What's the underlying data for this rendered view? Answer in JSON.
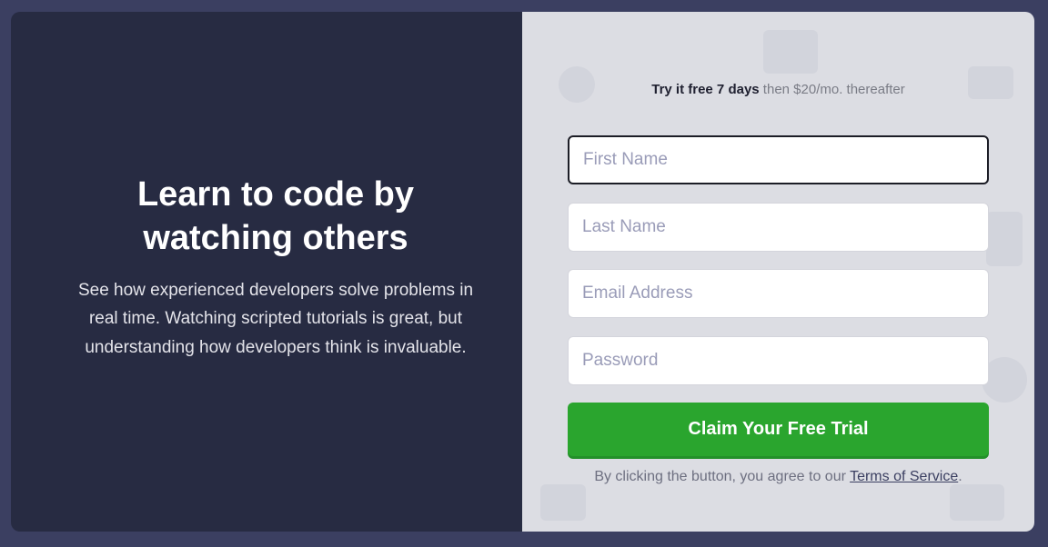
{
  "hero": {
    "headline_line1": "Learn to code by",
    "headline_line2": "watching others",
    "description": "See how experienced developers solve problems in real time. Watching scripted tutorials is great, but understanding how developers think is invaluable."
  },
  "offer": {
    "bold": "Try it free 7 days",
    "rest": " then $20/mo. thereafter"
  },
  "form": {
    "first_name_placeholder": "First Name",
    "last_name_placeholder": "Last Name",
    "email_placeholder": "Email Address",
    "password_placeholder": "Password",
    "submit_label": "Claim Your Free Trial"
  },
  "terms": {
    "prefix": "By clicking the button, you agree to our ",
    "link": "Terms of Service",
    "suffix": "."
  },
  "colors": {
    "page_bg": "#3b3f61",
    "left_panel": "#272b42",
    "right_panel": "#dcdde3",
    "cta": "#2aa52e"
  }
}
